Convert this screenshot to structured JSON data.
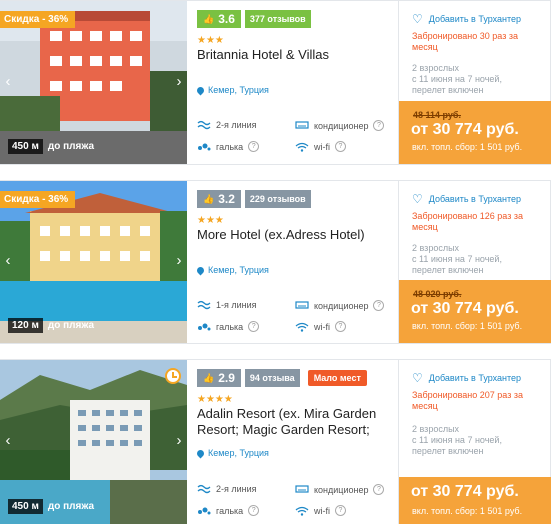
{
  "hotels": [
    {
      "discount": "Скидка - 36%",
      "distance": "450 м",
      "distance_label": "до пляжа",
      "score": "3.6",
      "reviews": "377 отзывов",
      "stars": "★★★",
      "name": "Britannia Hotel & Villas",
      "location": "Кемер, Турция",
      "line": "2-я линия",
      "beach": "галька",
      "ac": "кондиционер",
      "wifi": "wi-fi",
      "help": "?",
      "favorite": "Добавить в Турхантер",
      "booked": "Забронировано 30 раз за месяц",
      "details": [
        "2 взрослых",
        "с 11 июня на 7 ночей,",
        "перелет включен"
      ],
      "old_price": "48 114 руб.",
      "price": "от 30 774 руб.",
      "fee": "вкл. топл. сбор: 1 501 руб."
    },
    {
      "discount": "Скидка - 36%",
      "distance": "120 м",
      "distance_label": "до пляжа",
      "score": "3.2",
      "reviews": "229 отзывов",
      "stars": "★★★",
      "name": "More Hotel (ex.Adress Hotel)",
      "location": "Кемер, Турция",
      "line": "1-я линия",
      "beach": "галька",
      "ac": "кондиционер",
      "wifi": "wi-fi",
      "help": "?",
      "favorite": "Добавить в Турхантер",
      "booked": "Забронировано 126 раз за месяц",
      "details": [
        "2 взрослых",
        "с 11 июня на 7 ночей,",
        "перелет включен"
      ],
      "old_price": "48 020 руб.",
      "price": "от 30 774 руб.",
      "fee": "вкл. топл. сбор: 1 501 руб."
    },
    {
      "distance": "450 м",
      "distance_label": "до пляжа",
      "score": "2.9",
      "reviews": "94 отзыва",
      "few_places": "Мало мест",
      "stars": "★★★★",
      "name": "Adalin Resort (ex. Mira Garden Resort; Magic Garden Resort;",
      "location": "Кемер, Турция",
      "line": "2-я линия",
      "beach": "галька",
      "ac": "кондиционер",
      "wifi": "wi-fi",
      "help": "?",
      "favorite": "Добавить в Турхантер",
      "booked": "Забронировано 207 раз за месяц",
      "details": [
        "2 взрослых",
        "с 11 июня на 7 ночей,",
        "перелет включен"
      ],
      "price": "от 30 774 руб.",
      "fee": "вкл. топл. сбор: 1 501 руб."
    }
  ],
  "arrows": {
    "prev": "‹",
    "next": "›"
  },
  "colors": {
    "accent": "#1e88c7",
    "orange": "#f5a33a",
    "alert": "#f05a28",
    "rating_green": "#7ac142",
    "rating_gray": "#8796a3"
  }
}
